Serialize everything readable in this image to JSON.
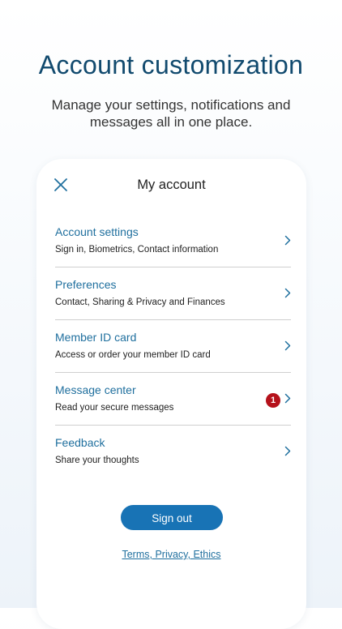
{
  "headline": "Account customization",
  "subheadline": "Manage your settings, notifications and messages all in one place.",
  "card": {
    "title": "My account",
    "menu": [
      {
        "title": "Account settings",
        "subtitle": "Sign in, Biometrics, Contact information"
      },
      {
        "title": "Preferences",
        "subtitle": "Contact, Sharing & Privacy and Finances"
      },
      {
        "title": "Member ID card",
        "subtitle": "Access or order your member ID card"
      },
      {
        "title": "Message center",
        "subtitle": "Read your secure messages",
        "badge": "1"
      },
      {
        "title": "Feedback",
        "subtitle": "Share your thoughts"
      }
    ],
    "sign_out_label": "Sign out",
    "footer_link": "Terms, Privacy, Ethics"
  },
  "icons": {
    "close": "close-icon",
    "chevron": "chevron-right-icon"
  },
  "colors": {
    "headline": "#114a6e",
    "link": "#1f6f9e",
    "button": "#1873b5",
    "badge": "#b5121b",
    "divider": "#cfcfcf"
  }
}
